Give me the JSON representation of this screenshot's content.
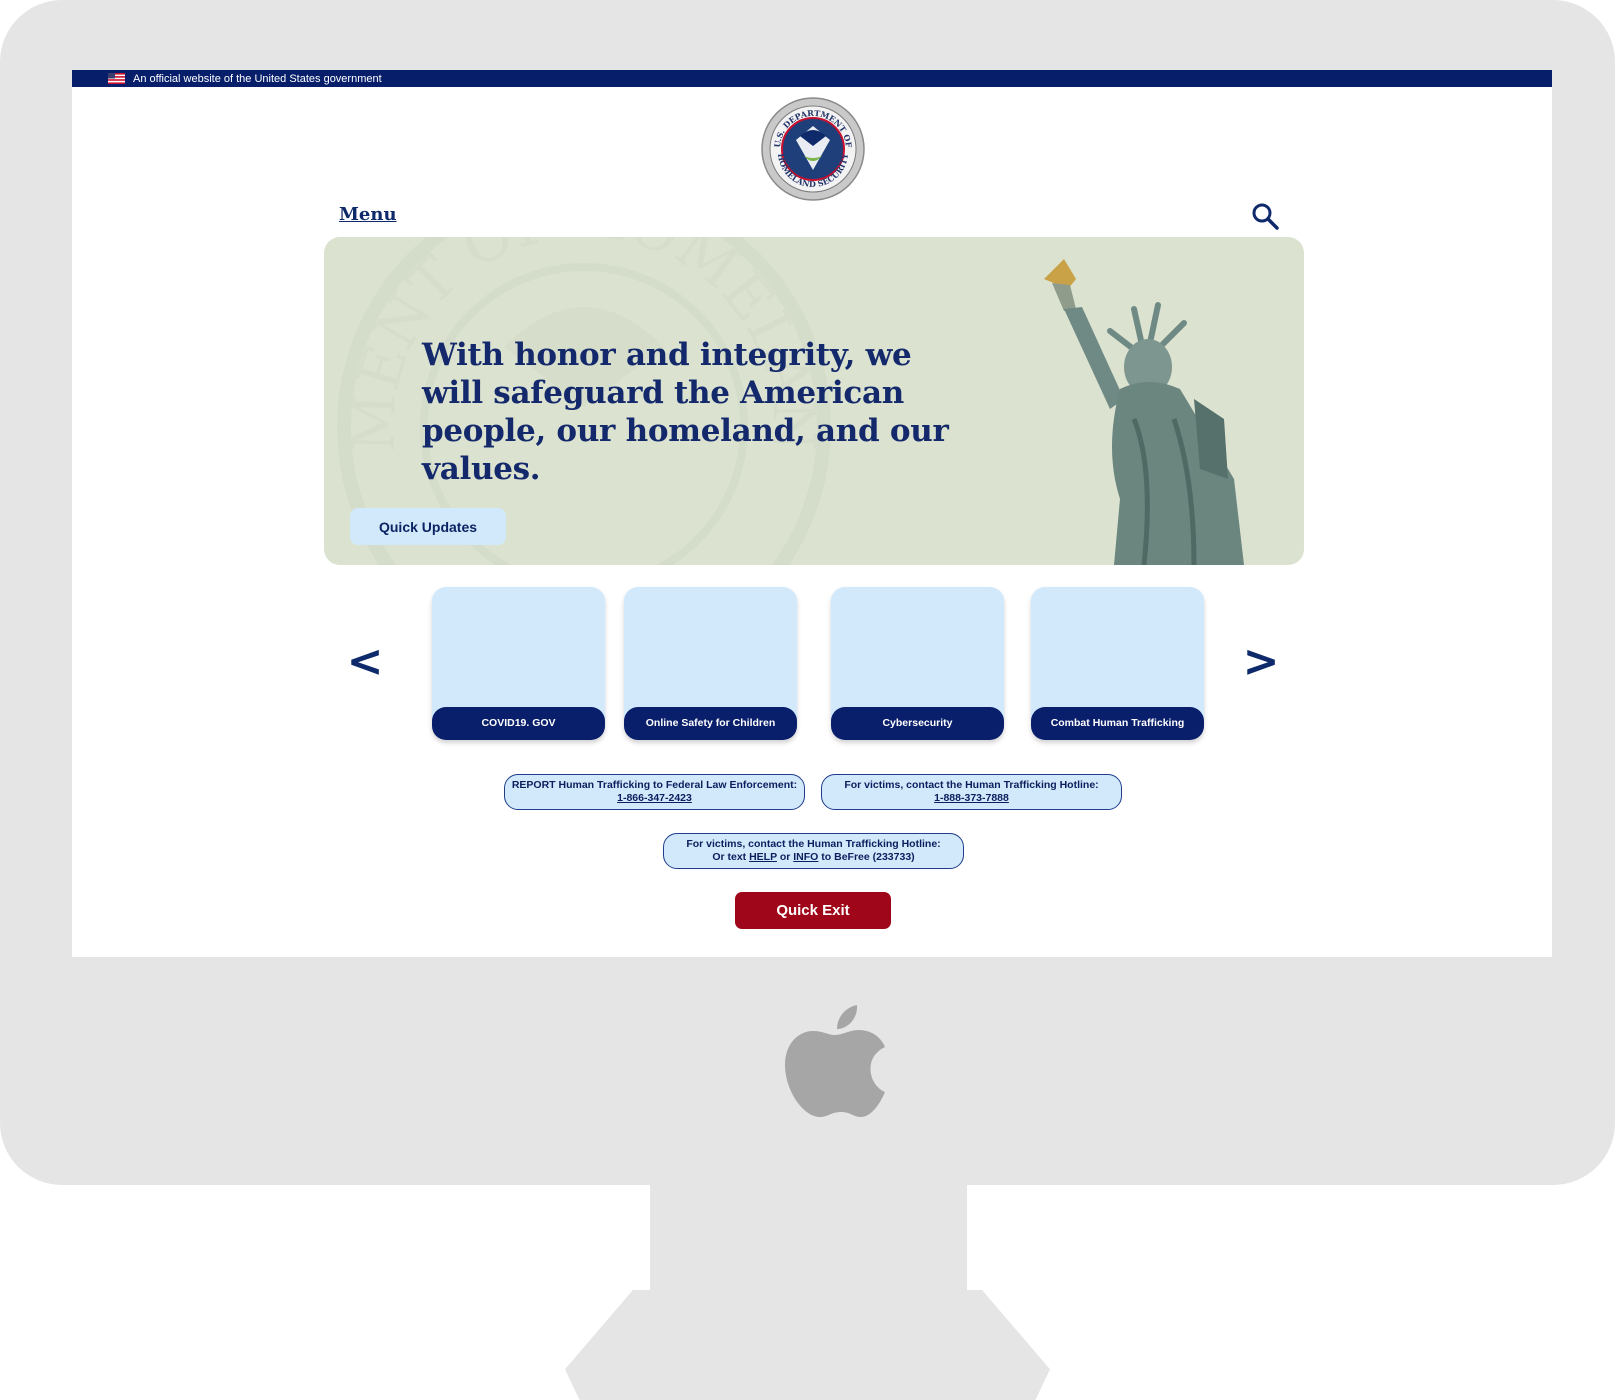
{
  "gov_banner": {
    "text": "An official website of the United States government"
  },
  "header": {
    "seal_text_top": "U.S. DEPARTMENT OF",
    "seal_text_bottom": "HOMELAND SECURITY",
    "menu_label": "Menu"
  },
  "hero": {
    "title": "With honor and integrity, we will safeguard the American people, our homeland, and our values.",
    "quick_updates_label": "Quick Updates",
    "watermark_text": "U.S. DEPARTMENT OF HOMELAND SECURITY"
  },
  "carousel": {
    "prev_label": "<",
    "next_label": ">",
    "cards": [
      {
        "label": "COVID19. GOV"
      },
      {
        "label": "Online Safety for Children"
      },
      {
        "label": "Cybersecurity"
      },
      {
        "label": "Combat Human Trafficking"
      }
    ]
  },
  "contacts": {
    "report_text": "REPORT Human Trafficking to Federal Law Enforcement:",
    "report_phone": "1-866-347-2423",
    "hotline_text": "For victims, contact the Human Trafficking Hotline:",
    "hotline_phone": "1-888-373-7888",
    "text_line1": "For victims, contact the Human Trafficking Hotline:",
    "text_prefix": "Or text",
    "text_help": "HELP",
    "text_or": "or",
    "text_info": "INFO",
    "text_suffix": "to BeFree (233733)"
  },
  "quick_exit_label": "Quick Exit",
  "colors": {
    "navy": "#0a1f6b",
    "light_blue": "#d2e9fb",
    "hero_bg": "#dbe2d0",
    "exit_red": "#a0061a",
    "device_gray": "#e5e5e5"
  }
}
